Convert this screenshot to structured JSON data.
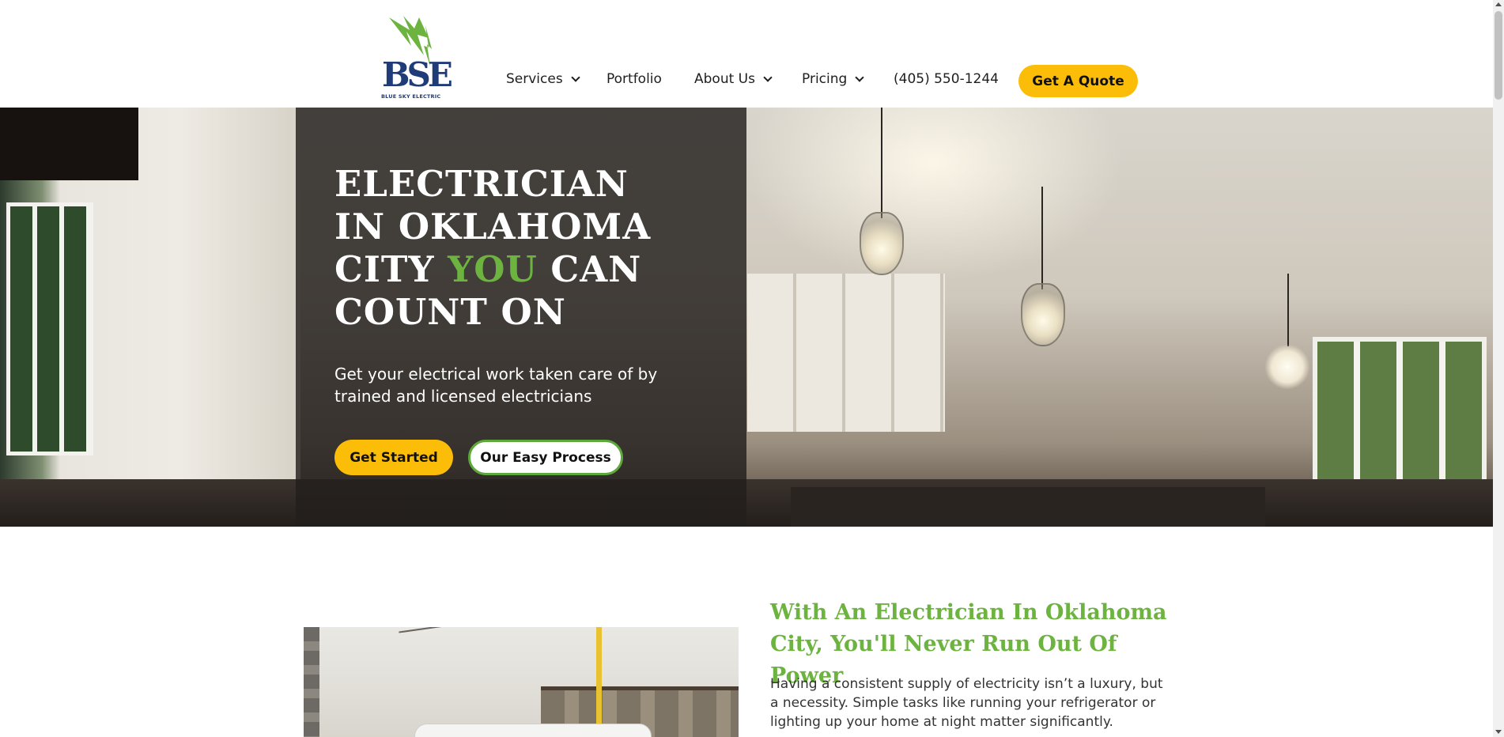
{
  "header": {
    "logo_text": "BSE",
    "logo_subtitle": "BLUE SKY ELECTRIC",
    "nav": [
      {
        "label": "Services",
        "has_dropdown": true
      },
      {
        "label": "Portfolio",
        "has_dropdown": false
      },
      {
        "label": "About Us",
        "has_dropdown": true
      },
      {
        "label": "Pricing",
        "has_dropdown": true
      }
    ],
    "phone": "(405) 550-1244",
    "quote_button": "Get A Quote"
  },
  "hero": {
    "title_line1": "ELECTRICIAN",
    "title_line2": "IN OKLAHOMA",
    "title_line3_pre": "CITY ",
    "title_line3_accent": "YOU",
    "title_line3_post": " CAN",
    "title_line4": "COUNT ON",
    "subtitle": "Get your electrical work taken care of by trained and licensed electricians",
    "primary_button": "Get Started",
    "secondary_button": "Our Easy Process"
  },
  "intro": {
    "title": "With An Electrician In Oklahoma City, You'll Never Run Out Of Power",
    "body": "Having a consistent supply of electricity isn’t a luxury, but a necessity. Simple tasks like running your refrigerator or lighting up your home at night matter significantly."
  },
  "colors": {
    "brand_green": "#6cb33f",
    "button_yellow": "#fbbd08",
    "logo_blue": "#1f3b78",
    "hero_overlay": "#221e1c"
  }
}
